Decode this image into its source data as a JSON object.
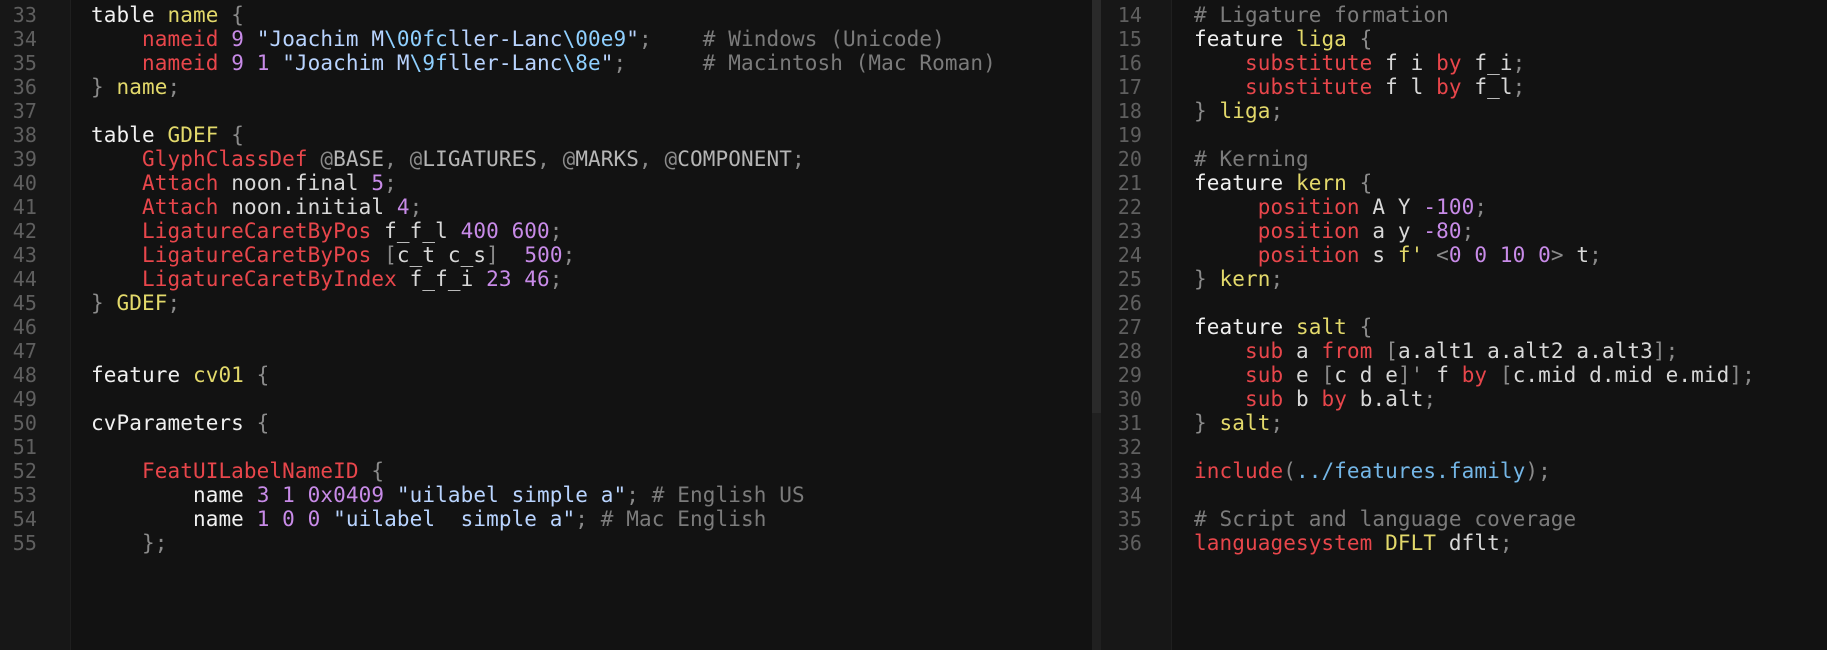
{
  "colors": {
    "background": "#121212",
    "gutter": "#171717",
    "keyword": "#f0f0f0",
    "name": "#e3d96b",
    "statement": "#e8464b",
    "number": "#c88be8",
    "string": "#b9d4ff",
    "comment": "#7b7b7b"
  },
  "left_pane": {
    "lines": [
      {
        "n": "33",
        "tokens": [
          [
            "t-kw",
            "table "
          ],
          [
            "t-name",
            "name"
          ],
          [
            "t-punct",
            " {"
          ]
        ]
      },
      {
        "n": "34",
        "tokens": [
          [
            "t-plain",
            "    "
          ],
          [
            "t-stmt",
            "nameid"
          ],
          [
            "t-plain",
            " "
          ],
          [
            "t-num",
            "9"
          ],
          [
            "t-plain",
            " "
          ],
          [
            "t-str",
            "\"Joachim M"
          ],
          [
            "t-esc",
            "\\00fc"
          ],
          [
            "t-str",
            "ller-Lanc"
          ],
          [
            "t-esc",
            "\\00e9"
          ],
          [
            "t-str",
            "\""
          ],
          [
            "t-punct",
            ";"
          ],
          [
            "t-plain",
            "    "
          ],
          [
            "t-cmt",
            "# Windows (Unicode)"
          ]
        ]
      },
      {
        "n": "35",
        "tokens": [
          [
            "t-plain",
            "    "
          ],
          [
            "t-stmt",
            "nameid"
          ],
          [
            "t-plain",
            " "
          ],
          [
            "t-num",
            "9 1"
          ],
          [
            "t-plain",
            " "
          ],
          [
            "t-str",
            "\"Joachim M"
          ],
          [
            "t-esc",
            "\\9f"
          ],
          [
            "t-str",
            "ller-Lanc"
          ],
          [
            "t-esc",
            "\\8e"
          ],
          [
            "t-str",
            "\""
          ],
          [
            "t-punct",
            ";"
          ],
          [
            "t-plain",
            "      "
          ],
          [
            "t-cmt",
            "# Macintosh (Mac Roman)"
          ]
        ]
      },
      {
        "n": "36",
        "tokens": [
          [
            "t-punct",
            "} "
          ],
          [
            "t-name",
            "name"
          ],
          [
            "t-punct",
            ";"
          ]
        ]
      },
      {
        "n": "37",
        "tokens": []
      },
      {
        "n": "38",
        "tokens": [
          [
            "t-kw",
            "table "
          ],
          [
            "t-name",
            "GDEF"
          ],
          [
            "t-punct",
            " {"
          ]
        ]
      },
      {
        "n": "39",
        "tokens": [
          [
            "t-plain",
            "    "
          ],
          [
            "t-stmt",
            "GlyphClassDef"
          ],
          [
            "t-plain",
            " "
          ],
          [
            "t-punct",
            "@"
          ],
          [
            "t-class",
            "BASE"
          ],
          [
            "t-punct",
            ", @"
          ],
          [
            "t-class",
            "LIGATURES"
          ],
          [
            "t-punct",
            ", @"
          ],
          [
            "t-class",
            "MARKS"
          ],
          [
            "t-punct",
            ", @"
          ],
          [
            "t-class",
            "COMPONENT"
          ],
          [
            "t-punct",
            ";"
          ]
        ]
      },
      {
        "n": "40",
        "tokens": [
          [
            "t-plain",
            "    "
          ],
          [
            "t-stmt",
            "Attach"
          ],
          [
            "t-plain",
            " "
          ],
          [
            "t-glyph",
            "noon.final"
          ],
          [
            "t-plain",
            " "
          ],
          [
            "t-num",
            "5"
          ],
          [
            "t-punct",
            ";"
          ]
        ]
      },
      {
        "n": "41",
        "tokens": [
          [
            "t-plain",
            "    "
          ],
          [
            "t-stmt",
            "Attach"
          ],
          [
            "t-plain",
            " "
          ],
          [
            "t-glyph",
            "noon.initial"
          ],
          [
            "t-plain",
            " "
          ],
          [
            "t-num",
            "4"
          ],
          [
            "t-punct",
            ";"
          ]
        ]
      },
      {
        "n": "42",
        "tokens": [
          [
            "t-plain",
            "    "
          ],
          [
            "t-stmt",
            "LigatureCaretByPos"
          ],
          [
            "t-plain",
            " "
          ],
          [
            "t-glyph",
            "f_f_l"
          ],
          [
            "t-plain",
            " "
          ],
          [
            "t-num",
            "400 600"
          ],
          [
            "t-punct",
            ";"
          ]
        ]
      },
      {
        "n": "43",
        "tokens": [
          [
            "t-plain",
            "    "
          ],
          [
            "t-stmt",
            "LigatureCaretByPos"
          ],
          [
            "t-plain",
            " "
          ],
          [
            "t-punct",
            "["
          ],
          [
            "t-glyph",
            "c_t c_s"
          ],
          [
            "t-punct",
            "]"
          ],
          [
            "t-plain",
            "  "
          ],
          [
            "t-num",
            "500"
          ],
          [
            "t-punct",
            ";"
          ]
        ]
      },
      {
        "n": "44",
        "tokens": [
          [
            "t-plain",
            "    "
          ],
          [
            "t-stmt",
            "LigatureCaretByIndex"
          ],
          [
            "t-plain",
            " "
          ],
          [
            "t-glyph",
            "f_f_i"
          ],
          [
            "t-plain",
            " "
          ],
          [
            "t-num",
            "23 46"
          ],
          [
            "t-punct",
            ";"
          ]
        ]
      },
      {
        "n": "45",
        "tokens": [
          [
            "t-punct",
            "} "
          ],
          [
            "t-name",
            "GDEF"
          ],
          [
            "t-punct",
            ";"
          ]
        ]
      },
      {
        "n": "46",
        "tokens": []
      },
      {
        "n": "47",
        "tokens": []
      },
      {
        "n": "48",
        "tokens": [
          [
            "t-kw",
            "feature "
          ],
          [
            "t-name",
            "cv01"
          ],
          [
            "t-punct",
            " {"
          ]
        ]
      },
      {
        "n": "49",
        "tokens": []
      },
      {
        "n": "50",
        "tokens": [
          [
            "t-kw",
            "cvParameters"
          ],
          [
            "t-punct",
            " {"
          ]
        ]
      },
      {
        "n": "51",
        "tokens": []
      },
      {
        "n": "52",
        "tokens": [
          [
            "t-plain",
            "    "
          ],
          [
            "t-stmt",
            "FeatUILabelNameID"
          ],
          [
            "t-punct",
            " {"
          ]
        ]
      },
      {
        "n": "53",
        "tokens": [
          [
            "t-plain",
            "        "
          ],
          [
            "t-kw",
            "name"
          ],
          [
            "t-plain",
            " "
          ],
          [
            "t-num",
            "3 1 0x0409"
          ],
          [
            "t-plain",
            " "
          ],
          [
            "t-str",
            "\"uilabel simple a\""
          ],
          [
            "t-punct",
            ";"
          ],
          [
            "t-plain",
            " "
          ],
          [
            "t-cmt",
            "# English US"
          ]
        ]
      },
      {
        "n": "54",
        "tokens": [
          [
            "t-plain",
            "        "
          ],
          [
            "t-kw",
            "name"
          ],
          [
            "t-plain",
            " "
          ],
          [
            "t-num",
            "1 0 0"
          ],
          [
            "t-plain",
            " "
          ],
          [
            "t-str",
            "\"uilabel  simple a\""
          ],
          [
            "t-punct",
            ";"
          ],
          [
            "t-plain",
            " "
          ],
          [
            "t-cmt",
            "# Mac English"
          ]
        ]
      },
      {
        "n": "55",
        "tokens": [
          [
            "t-plain",
            "    "
          ],
          [
            "t-punct",
            "};"
          ]
        ]
      }
    ]
  },
  "right_pane": {
    "lines": [
      {
        "n": "14",
        "tokens": [
          [
            "t-cmt",
            "# Ligature formation"
          ]
        ]
      },
      {
        "n": "15",
        "tokens": [
          [
            "t-kw",
            "feature "
          ],
          [
            "t-name",
            "liga"
          ],
          [
            "t-punct",
            " {"
          ]
        ]
      },
      {
        "n": "16",
        "tokens": [
          [
            "t-plain",
            "    "
          ],
          [
            "t-stmt",
            "substitute"
          ],
          [
            "t-plain",
            " "
          ],
          [
            "t-glyph",
            "f i"
          ],
          [
            "t-plain",
            " "
          ],
          [
            "t-stmt",
            "by"
          ],
          [
            "t-plain",
            " "
          ],
          [
            "t-glyph",
            "f_i"
          ],
          [
            "t-punct",
            ";"
          ]
        ]
      },
      {
        "n": "17",
        "tokens": [
          [
            "t-plain",
            "    "
          ],
          [
            "t-stmt",
            "substitute"
          ],
          [
            "t-plain",
            " "
          ],
          [
            "t-glyph",
            "f l"
          ],
          [
            "t-plain",
            " "
          ],
          [
            "t-stmt",
            "by"
          ],
          [
            "t-plain",
            " "
          ],
          [
            "t-glyph",
            "f_l"
          ],
          [
            "t-punct",
            ";"
          ]
        ]
      },
      {
        "n": "18",
        "tokens": [
          [
            "t-punct",
            "} "
          ],
          [
            "t-name",
            "liga"
          ],
          [
            "t-punct",
            ";"
          ]
        ]
      },
      {
        "n": "19",
        "tokens": []
      },
      {
        "n": "20",
        "tokens": [
          [
            "t-cmt",
            "# Kerning"
          ]
        ]
      },
      {
        "n": "21",
        "tokens": [
          [
            "t-kw",
            "feature "
          ],
          [
            "t-name",
            "kern"
          ],
          [
            "t-punct",
            " {"
          ]
        ]
      },
      {
        "n": "22",
        "tokens": [
          [
            "t-plain",
            "     "
          ],
          [
            "t-stmt",
            "position"
          ],
          [
            "t-plain",
            " "
          ],
          [
            "t-glyph",
            "A Y"
          ],
          [
            "t-plain",
            " "
          ],
          [
            "t-num",
            "-100"
          ],
          [
            "t-punct",
            ";"
          ]
        ]
      },
      {
        "n": "23",
        "tokens": [
          [
            "t-plain",
            "     "
          ],
          [
            "t-stmt",
            "position"
          ],
          [
            "t-plain",
            " "
          ],
          [
            "t-glyph",
            "a y"
          ],
          [
            "t-plain",
            " "
          ],
          [
            "t-num",
            "-80"
          ],
          [
            "t-punct",
            ";"
          ]
        ]
      },
      {
        "n": "24",
        "tokens": [
          [
            "t-plain",
            "     "
          ],
          [
            "t-stmt",
            "position"
          ],
          [
            "t-plain",
            " "
          ],
          [
            "t-glyph",
            "s "
          ],
          [
            "t-name",
            "f'"
          ],
          [
            "t-plain",
            " "
          ],
          [
            "t-punct",
            "<"
          ],
          [
            "t-num",
            "0 0 10 0"
          ],
          [
            "t-punct",
            ">"
          ],
          [
            "t-plain",
            " "
          ],
          [
            "t-glyph",
            "t"
          ],
          [
            "t-punct",
            ";"
          ]
        ]
      },
      {
        "n": "25",
        "tokens": [
          [
            "t-punct",
            "} "
          ],
          [
            "t-name",
            "kern"
          ],
          [
            "t-punct",
            ";"
          ]
        ]
      },
      {
        "n": "26",
        "tokens": []
      },
      {
        "n": "27",
        "tokens": [
          [
            "t-kw",
            "feature "
          ],
          [
            "t-name",
            "salt"
          ],
          [
            "t-punct",
            " {"
          ]
        ]
      },
      {
        "n": "28",
        "tokens": [
          [
            "t-plain",
            "    "
          ],
          [
            "t-stmt",
            "sub"
          ],
          [
            "t-plain",
            " "
          ],
          [
            "t-glyph",
            "a"
          ],
          [
            "t-plain",
            " "
          ],
          [
            "t-stmt",
            "from"
          ],
          [
            "t-plain",
            " "
          ],
          [
            "t-punct",
            "["
          ],
          [
            "t-glyph",
            "a.alt1 a.alt2 a.alt3"
          ],
          [
            "t-punct",
            "];"
          ]
        ]
      },
      {
        "n": "29",
        "tokens": [
          [
            "t-plain",
            "    "
          ],
          [
            "t-stmt",
            "sub"
          ],
          [
            "t-plain",
            " "
          ],
          [
            "t-glyph",
            "e"
          ],
          [
            "t-plain",
            " "
          ],
          [
            "t-punct",
            "["
          ],
          [
            "t-glyph",
            "c d e"
          ],
          [
            "t-punct",
            "]'"
          ],
          [
            "t-plain",
            " "
          ],
          [
            "t-glyph",
            "f"
          ],
          [
            "t-plain",
            " "
          ],
          [
            "t-stmt",
            "by"
          ],
          [
            "t-plain",
            " "
          ],
          [
            "t-punct",
            "["
          ],
          [
            "t-glyph",
            "c.mid d.mid e.mid"
          ],
          [
            "t-punct",
            "];"
          ]
        ]
      },
      {
        "n": "30",
        "tokens": [
          [
            "t-plain",
            "    "
          ],
          [
            "t-stmt",
            "sub"
          ],
          [
            "t-plain",
            " "
          ],
          [
            "t-glyph",
            "b"
          ],
          [
            "t-plain",
            " "
          ],
          [
            "t-stmt",
            "by"
          ],
          [
            "t-plain",
            " "
          ],
          [
            "t-glyph",
            "b.alt"
          ],
          [
            "t-punct",
            ";"
          ]
        ]
      },
      {
        "n": "31",
        "tokens": [
          [
            "t-punct",
            "} "
          ],
          [
            "t-name",
            "salt"
          ],
          [
            "t-punct",
            ";"
          ]
        ]
      },
      {
        "n": "32",
        "tokens": []
      },
      {
        "n": "33",
        "tokens": [
          [
            "t-stmt",
            "include"
          ],
          [
            "t-punct",
            "("
          ],
          [
            "t-path",
            "../features.family"
          ],
          [
            "t-punct",
            ");"
          ]
        ]
      },
      {
        "n": "34",
        "tokens": []
      },
      {
        "n": "35",
        "tokens": [
          [
            "t-cmt",
            "# Script and language coverage"
          ]
        ]
      },
      {
        "n": "36",
        "tokens": [
          [
            "t-stmt",
            "languagesystem"
          ],
          [
            "t-plain",
            " "
          ],
          [
            "t-name",
            "DFLT"
          ],
          [
            "t-plain",
            " "
          ],
          [
            "t-glyph",
            "dflt"
          ],
          [
            "t-punct",
            ";"
          ]
        ]
      }
    ]
  }
}
